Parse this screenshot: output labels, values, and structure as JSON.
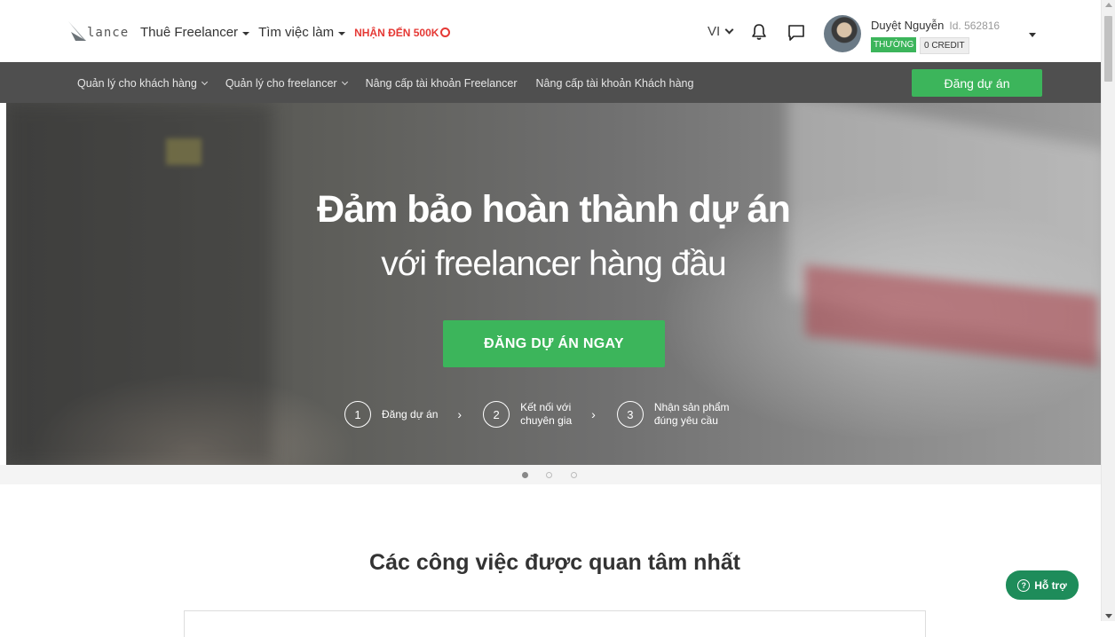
{
  "logo": {
    "text": "lance"
  },
  "topnav": {
    "hire_freelancer": "Thuê Freelancer",
    "find_jobs": "Tìm việc làm",
    "promo": "NHẬN ĐẾN 500K"
  },
  "language": "VI",
  "user": {
    "name": "Duyệt Nguyễn",
    "id_label": "Id. 562816",
    "tier": "THƯỜNG",
    "credit": "0 CREDIT"
  },
  "subnav": {
    "items": [
      {
        "label": "Quản lý cho khách hàng"
      },
      {
        "label": "Quản lý cho freelancer"
      },
      {
        "label": "Nâng cấp tài khoản Freelancer"
      },
      {
        "label": "Nâng cấp tài khoản Khách hàng"
      }
    ],
    "post_project": "Đăng dự án"
  },
  "hero": {
    "title": "Đảm bảo hoàn thành dự án",
    "subtitle": "với freelancer hàng đầu",
    "cta": "ĐĂNG DỰ ÁN NGAY",
    "steps": [
      {
        "num": "1",
        "line1": "Đăng dự án",
        "line2": ""
      },
      {
        "num": "2",
        "line1": "Kết nối với",
        "line2": "chuyên gia"
      },
      {
        "num": "3",
        "line1": "Nhận sản phẩm",
        "line2": "đúng yêu cầu"
      }
    ],
    "carousel_slides": 3,
    "carousel_active": 1
  },
  "section": {
    "title": "Các công việc được quan tâm nhất"
  },
  "help": {
    "label": "Hỗ trợ"
  },
  "colors": {
    "green": "#3cb55b",
    "promo_red": "#e53935",
    "subnav_bg": "#4f4f4f",
    "help_green": "#1e8c5a"
  }
}
